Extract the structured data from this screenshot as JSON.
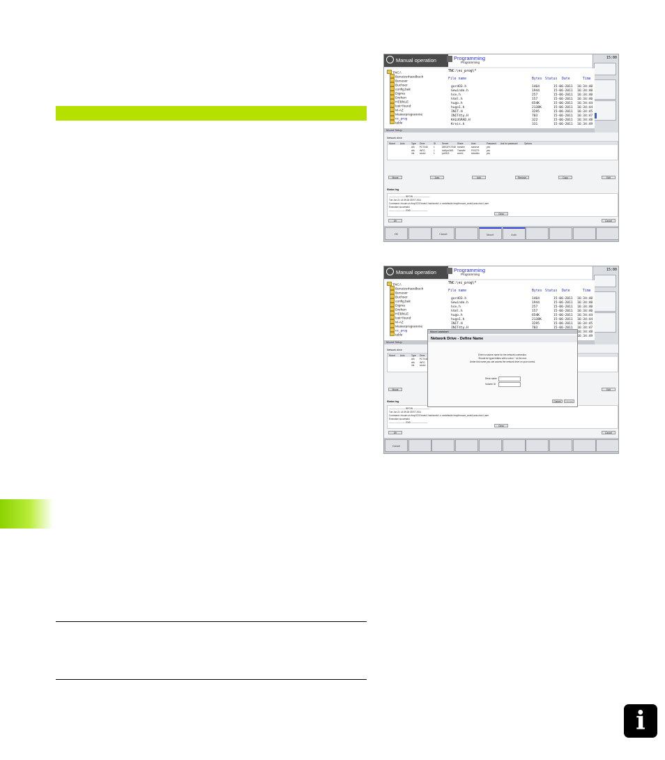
{
  "page": {
    "info_icon_glyph": "i",
    "green_color": "#b5e000"
  },
  "screen1": {
    "mode_left": "Manual operation",
    "mode_right": "Programming",
    "mode_right_sub": "Programming",
    "clock": "15:00",
    "clock2": "S 50%",
    "tree_root": "TNC:\\",
    "tree": [
      "Benutzerhandbuch",
      "Benuser",
      "Buchser",
      "config.bak",
      "Digma",
      "Drehen",
      "HEBNLE",
      "lost+found",
      "M-AZ",
      "Musterprogramme",
      "nc_prog",
      "table"
    ],
    "path": "TNC:\\nc_prog\\*",
    "col_file": "File name",
    "col_bytes": "Bytes",
    "col_status": "Status",
    "col_date": "Date",
    "col_time": "Time",
    "files": [
      {
        "name": "gordO3.h",
        "bytes": "1464",
        "date": "15-06-2011",
        "time": "16:34:40"
      },
      {
        "name": "Gewinde.h",
        "bytes": "1944",
        "date": "15-06-2011",
        "time": "16:34:40"
      },
      {
        "name": "hse.h",
        "bytes": "257",
        "date": "15-06-2011",
        "time": "16:34:40"
      },
      {
        "name": "html.h",
        "bytes": "157",
        "date": "15-06-2011",
        "time": "16:34:40"
      },
      {
        "name": "hugo.h",
        "bytes": "654K",
        "date": "15-06-2011",
        "time": "16:34:44"
      },
      {
        "name": "hugo1.h",
        "bytes": "2138K",
        "date": "15-06-2011",
        "time": "16:34:44"
      },
      {
        "name": "INIT.H",
        "bytes": "3295",
        "date": "15-06-2011",
        "time": "16:34:45"
      },
      {
        "name": "INIT4ty.H",
        "bytes": "703",
        "date": "15-06-2011",
        "time": "16:34:47"
      },
      {
        "name": "KALUGRAD.H",
        "bytes": "322",
        "date": "15-06-2011",
        "time": "16:34:48"
      },
      {
        "name": "Kreis.h",
        "bytes": "331",
        "date": "15-06-2011",
        "time": "16:34:49"
      }
    ],
    "dialog_title": "Mount Setup",
    "network_drive": "Network drive",
    "table_headers": [
      "Mount",
      "Auto",
      "Type",
      "Drive",
      "ID",
      "Server",
      "Share",
      "User",
      "Password",
      "Ask for password",
      "Options"
    ],
    "table_rows": [
      [
        "",
        "",
        "cifs",
        "PC7048",
        "1",
        "DBS1PC7048",
        "transfer",
        "sameue",
        "yes",
        "",
        ""
      ],
      [
        "",
        "",
        "cifs",
        "INFO",
        "1",
        "dof4pc0451",
        "Transfer",
        "PX0279",
        "yes",
        "",
        ""
      ],
      [
        "",
        "",
        "nfs",
        "work4",
        "1",
        "pc0515",
        "work4",
        "srlradiec",
        "yes",
        "",
        ""
      ]
    ],
    "buttons": [
      "Mount",
      "Auto",
      "Add",
      "Remove",
      "Copy",
      "Edit"
    ],
    "status_log": "Status log",
    "log_lines": [
      "---------------------- BEGIN ----------------------",
      "Tue Jun 21 14:39:26 CEST 2011",
      "Command: /mount.sh /tmp/2237/work4 /mnt/work4 -o vmdefaults /tmp/hmount_work4,auto,nsd=l,user",
      "Execution successful",
      "---------------------- END ----------------------"
    ],
    "clear_button": "Clear",
    "ok_button": "OK",
    "cancel_button": "Cancel",
    "softkeys": [
      "OK",
      "",
      "Cancel",
      "",
      "Mount",
      "Auto",
      "",
      "",
      "",
      ""
    ]
  },
  "screen2": {
    "modal_title": "Mount assistant",
    "modal_heading": "Network Drive - Define Name",
    "modal_text": [
      "Enter a volume name for the network connection.",
      "Should be typed letters with a colon ':' at the end.",
      "Under this name you can access the network drive on your control."
    ],
    "drive_name_label": "Drive name",
    "volume_id_label": "Volume ID",
    "modal_cancel": "Cancel",
    "modal_forward": "Forward",
    "softkeys": [
      "Cancel",
      "",
      "",
      "",
      "",
      "",
      "",
      "",
      "",
      ""
    ]
  }
}
